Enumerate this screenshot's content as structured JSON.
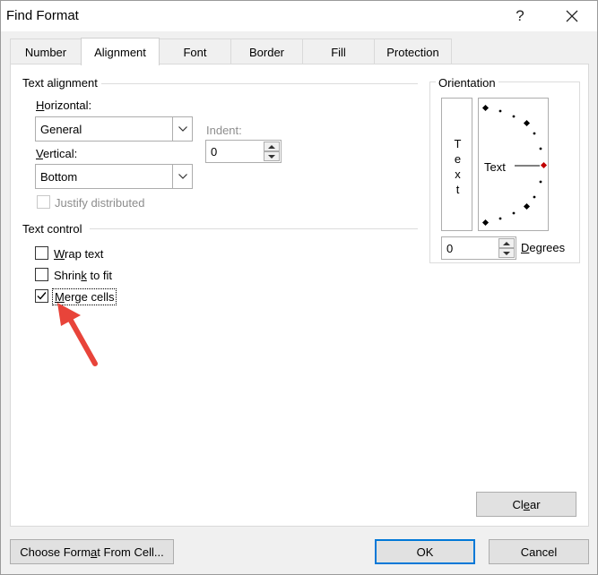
{
  "window": {
    "title": "Find Format",
    "help_glyph": "?",
    "close_glyph": "✕"
  },
  "tabs": [
    {
      "label": "Number",
      "active": false
    },
    {
      "label": "Alignment",
      "active": true
    },
    {
      "label": "Font",
      "active": false
    },
    {
      "label": "Border",
      "active": false
    },
    {
      "label": "Fill",
      "active": false
    },
    {
      "label": "Protection",
      "active": false
    }
  ],
  "text_alignment": {
    "title": "Text alignment",
    "horizontal_label": "Horizontal:",
    "horizontal_value": "General",
    "vertical_label": "Vertical:",
    "vertical_value": "Bottom",
    "indent_label": "Indent:",
    "indent_value": "0",
    "justify_label": "Justify distributed",
    "justify_checked": false
  },
  "text_control": {
    "title": "Text control",
    "wrap_label": "Wrap text",
    "wrap_checked": false,
    "shrink_label": "Shrink to fit",
    "shrink_checked": false,
    "merge_label": "Merge cells",
    "merge_checked": true
  },
  "orientation": {
    "title": "Orientation",
    "vertical_text": [
      "T",
      "e",
      "x",
      "t"
    ],
    "dial_text": "Text",
    "degrees_value": "0",
    "degrees_label": "Degrees"
  },
  "buttons": {
    "clear": "Clear",
    "choose_format": "Choose Format From Cell...",
    "ok": "OK",
    "cancel": "Cancel"
  },
  "colors": {
    "annotation_arrow": "#e8443a",
    "dial_marker": "#c00000",
    "focus_border": "#0078d7"
  },
  "icons": {
    "dropdown": "chevron-down-icon",
    "spin_up": "spin-up-icon",
    "spin_down": "spin-down-icon",
    "check": "checkmark-icon",
    "annotation": "red-arrow-annotation"
  }
}
